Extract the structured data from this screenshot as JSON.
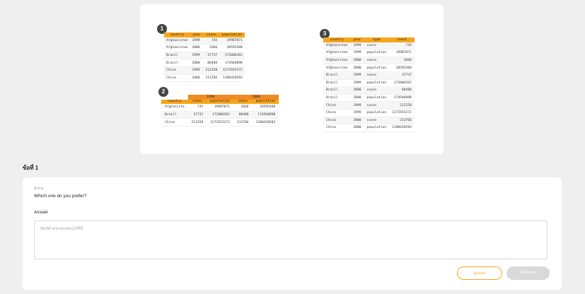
{
  "tables": {
    "t1": {
      "badge": "1",
      "headers": [
        "country",
        "year",
        "cases",
        "population"
      ],
      "rows": [
        [
          "Afghanistan",
          "1999",
          "745",
          "19987071"
        ],
        [
          "Afghanistan",
          "2000",
          "2666",
          "20595360"
        ],
        [
          "Brazil",
          "1999",
          "37737",
          "172006362"
        ],
        [
          "Brazil",
          "2000",
          "80488",
          "174504898"
        ],
        [
          "China",
          "1999",
          "212258",
          "1272915272"
        ],
        [
          "China",
          "2000",
          "213766",
          "1280428583"
        ]
      ]
    },
    "t2": {
      "badge": "2",
      "years": [
        "1999",
        "2000"
      ],
      "headers": [
        "country",
        "cases",
        "population",
        "cases",
        "population"
      ],
      "rows": [
        [
          "Afghanista",
          "745",
          "19987071",
          "2666",
          "20595360"
        ],
        [
          "Brazil",
          "37737",
          "172006362",
          "80488",
          "174504898"
        ],
        [
          "China",
          "212258",
          "1272915272",
          "213766",
          "1280428583"
        ]
      ]
    },
    "t3": {
      "badge": "3",
      "headers": [
        "country",
        "year",
        "type",
        "count"
      ],
      "rows": [
        [
          "Afghanistan",
          "1999",
          "cases",
          "745"
        ],
        [
          "Afghanistan",
          "1999",
          "population",
          "19987071"
        ],
        [
          "Afghanistan",
          "2000",
          "cases",
          "2666"
        ],
        [
          "Afghanistan",
          "2000",
          "population",
          "20595360"
        ],
        [
          "Brazil",
          "1999",
          "cases",
          "37737"
        ],
        [
          "Brazil",
          "1999",
          "population",
          "172006362"
        ],
        [
          "Brazil",
          "2000",
          "cases",
          "80488"
        ],
        [
          "Brazil",
          "2000",
          "population",
          "174504898"
        ],
        [
          "China",
          "1999",
          "cases",
          "212258"
        ],
        [
          "China",
          "1999",
          "population",
          "1272915272"
        ],
        [
          "China",
          "2000",
          "cases",
          "213766"
        ],
        [
          "China",
          "2000",
          "population",
          "1280428583"
        ]
      ]
    }
  },
  "section_title": "ข้อที่ 1",
  "question": {
    "small_label": "คำถาม",
    "text": "Which one do you prefer?",
    "answer_label": "Answer",
    "answer_placeholder": "พิมพ์คำตอบของคุณได้ที่นี่"
  },
  "buttons": {
    "skip": "ดูเฉลย",
    "submit": "ส่งคำตอบ"
  },
  "colors": {
    "header": "#f7a51c",
    "year_header": "#f08a22",
    "skip_border": "#f7a51c",
    "submit_bg": "#d9d9d9"
  }
}
